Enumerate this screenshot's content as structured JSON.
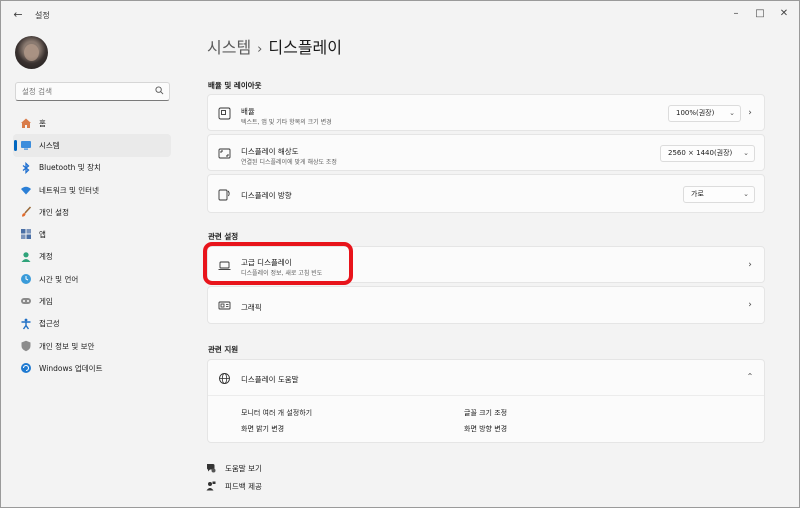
{
  "titlebar": {
    "app_title": "설정",
    "back": "←",
    "minimize": "–",
    "maximize": "□",
    "close": "✕"
  },
  "search": {
    "placeholder": "설정 검색",
    "value": ""
  },
  "sidebar": {
    "items": [
      {
        "label": "홈",
        "icon": "home-icon"
      },
      {
        "label": "시스템",
        "icon": "system-icon",
        "active": true
      },
      {
        "label": "Bluetooth 및 장치",
        "icon": "bluetooth-icon"
      },
      {
        "label": "네트워크 및 인터넷",
        "icon": "wifi-icon"
      },
      {
        "label": "개인 설정",
        "icon": "brush-icon"
      },
      {
        "label": "앱",
        "icon": "apps-icon"
      },
      {
        "label": "계정",
        "icon": "account-icon"
      },
      {
        "label": "시간 및 언어",
        "icon": "globe-clock-icon"
      },
      {
        "label": "게임",
        "icon": "gamepad-icon"
      },
      {
        "label": "접근성",
        "icon": "accessibility-icon"
      },
      {
        "label": "개인 정보 및 보안",
        "icon": "shield-icon"
      },
      {
        "label": "Windows 업데이트",
        "icon": "update-icon"
      }
    ]
  },
  "breadcrumb": {
    "parent": "시스템",
    "separator": "›",
    "current": "디스플레이"
  },
  "scale_layout": {
    "title": "배율 및 레이아웃",
    "scale": {
      "title": "배율",
      "subtitle": "텍스트, 앱 및 기타 항목의 크기 변경",
      "value": "100%(권장)"
    },
    "resolution": {
      "title": "디스플레이 해상도",
      "subtitle": "연결된 디스플레이에 맞게 해상도 조정",
      "value": "2560 × 1440(권장)"
    },
    "orientation": {
      "title": "디스플레이 방향",
      "value": "가로"
    }
  },
  "related_settings": {
    "title": "관련 설정",
    "advanced": {
      "title": "고급 디스플레이",
      "subtitle": "디스플레이 정보, 새로 고침 빈도"
    },
    "graphics": {
      "title": "그래픽"
    }
  },
  "related_support": {
    "title": "관련 지원",
    "help_title": "디스플레이 도움말",
    "links": [
      "모니터 여러 개 설정하기",
      "글꼴 크기 조정",
      "화면 밝기 변경",
      "화면 방향 변경"
    ]
  },
  "footer": {
    "get_help": "도움말 보기",
    "feedback": "피드백 제공"
  },
  "colors": {
    "accent": "#0067c0",
    "highlight_box": "#e8141b"
  }
}
